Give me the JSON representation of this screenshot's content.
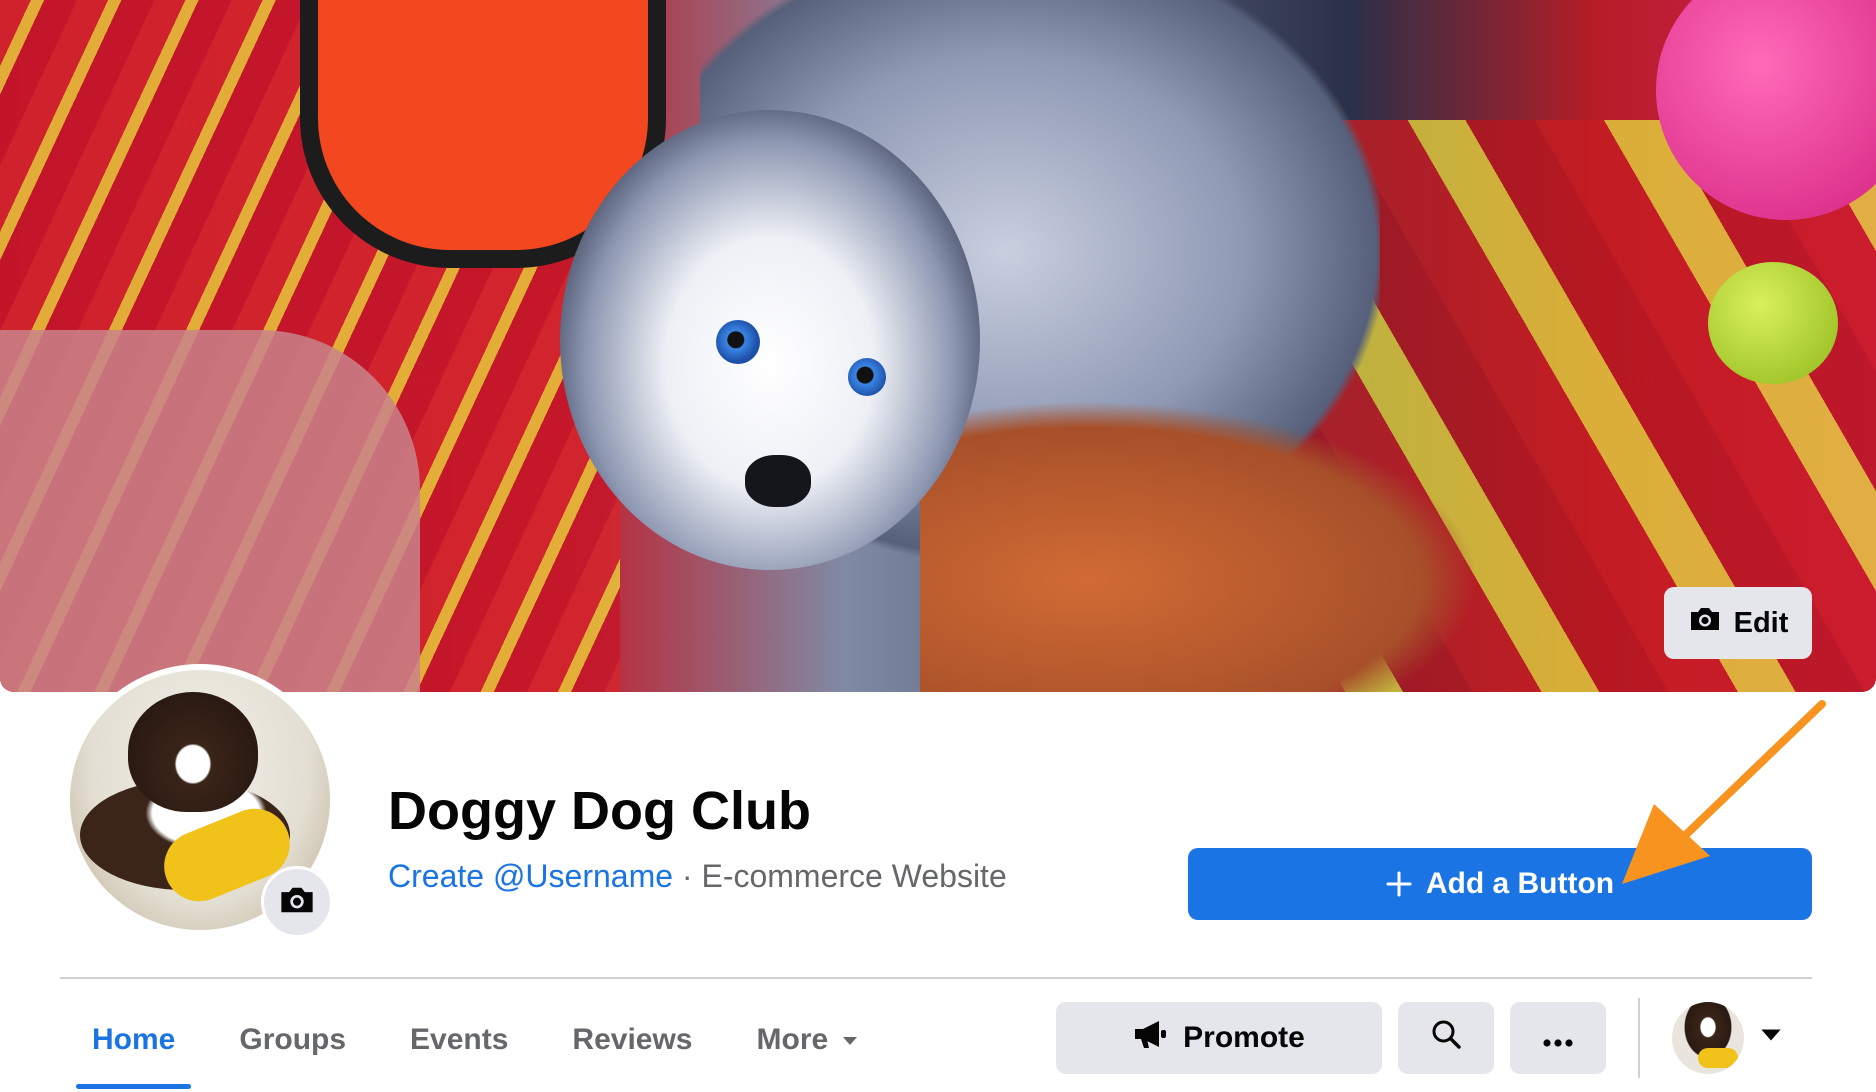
{
  "cover": {
    "edit_label": "Edit",
    "edit_icon": "camera-icon"
  },
  "profile": {
    "name": "Doggy Dog Club",
    "username_link": "Create @Username",
    "separator": "·",
    "category": "E-commerce Website",
    "avatar_edit_icon": "camera-icon"
  },
  "cta": {
    "add_button_label": "Add a Button",
    "icon": "plus-icon",
    "color": "#1b74e4"
  },
  "annotation": {
    "arrow_color": "#f7931e"
  },
  "nav": {
    "tabs": [
      {
        "label": "Home",
        "active": true
      },
      {
        "label": "Groups",
        "active": false
      },
      {
        "label": "Events",
        "active": false
      },
      {
        "label": "Reviews",
        "active": false
      },
      {
        "label": "More",
        "active": false,
        "has_dropdown": true
      }
    ],
    "actions": {
      "promote_label": "Promote",
      "promote_icon": "megaphone-icon",
      "search_icon": "search-icon",
      "more_icon": "ellipsis-icon",
      "account_icon": "caret-down-icon"
    }
  }
}
